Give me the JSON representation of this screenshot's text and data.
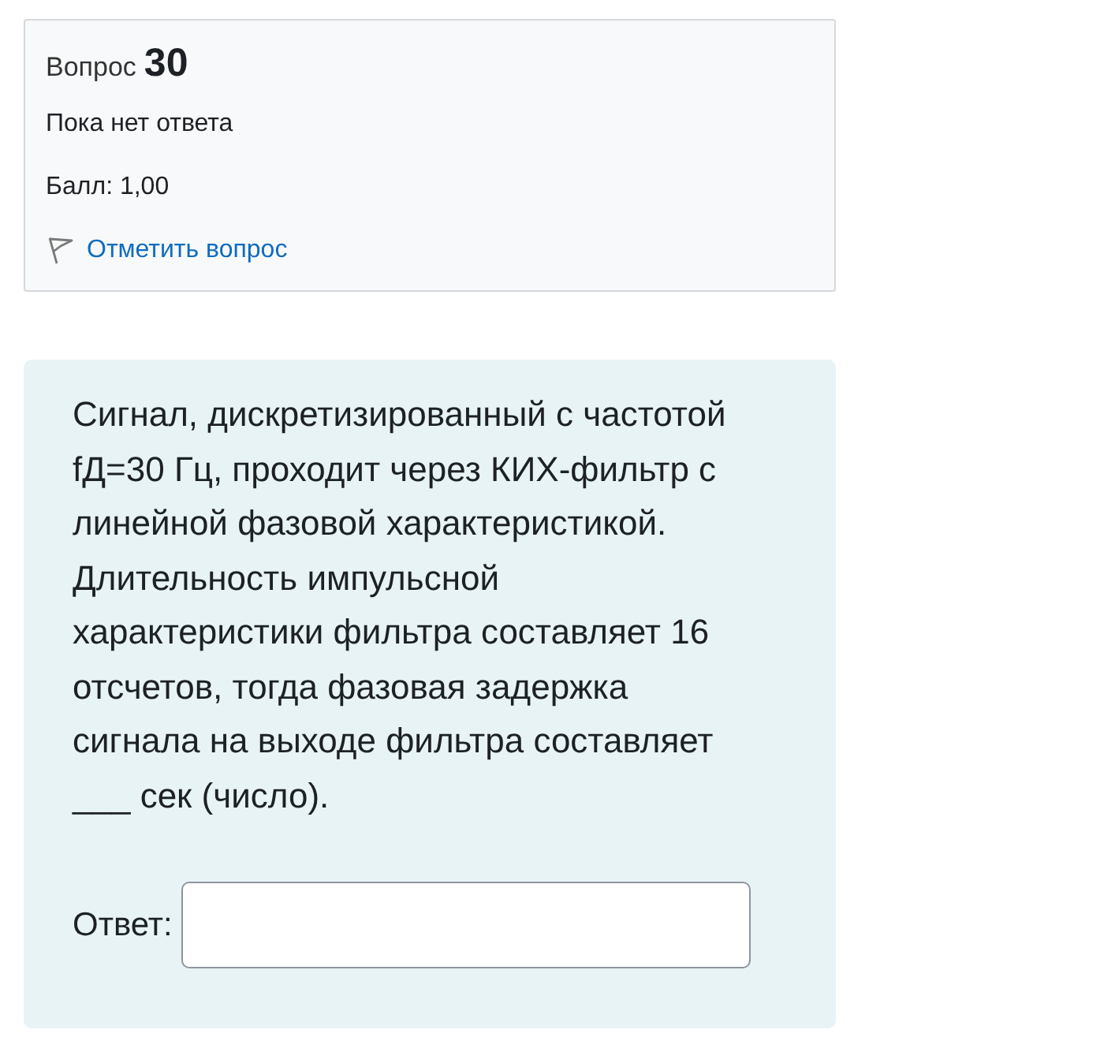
{
  "question_info": {
    "label": "Вопрос",
    "number": "30",
    "status": "Пока нет ответа",
    "grade": "Балл: 1,00",
    "flag_link": "Отметить вопрос"
  },
  "question": {
    "text": "Сигнал, дискретизированный с частотой fД=30 Гц, проходит через КИХ-фильтр с линейной фазовой характеристикой. Длительность импульсной характеристики фильтра составляет 16 отсчетов, тогда фазовая задержка сигнала на выходе фильтра составляет ___ сек (число).",
    "answer_label": "Ответ:"
  }
}
